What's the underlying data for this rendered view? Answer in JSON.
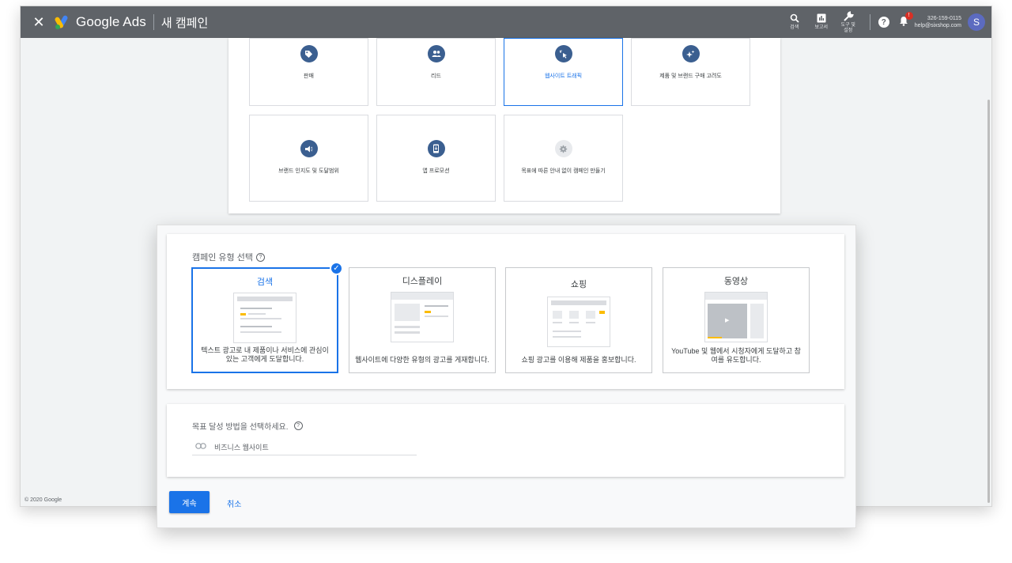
{
  "header": {
    "close_icon": "close-icon",
    "brand": "Google Ads",
    "page_title": "새 캠페인",
    "tools": [
      {
        "icon": "search-icon",
        "label": "검색"
      },
      {
        "icon": "reports-icon",
        "label": "보고서"
      },
      {
        "icon": "wrench-icon",
        "label": "도구 및 설정"
      }
    ],
    "notification_badge": "!",
    "account": {
      "id": "326-159-0115",
      "email": "help@sixshop.com",
      "avatar_letter": "S"
    }
  },
  "goals": [
    {
      "label": "판매",
      "icon": "tag-icon",
      "selected": false
    },
    {
      "label": "리드",
      "icon": "people-icon",
      "selected": false
    },
    {
      "label": "웹사이트 트래픽",
      "icon": "cursor-click-icon",
      "selected": true
    },
    {
      "label": "제품 및 브랜드 구매 고려도",
      "icon": "sparkle-icon",
      "selected": false
    },
    {
      "label": "브랜드 인지도 및 도달범위",
      "icon": "megaphone-icon",
      "selected": false
    },
    {
      "label": "앱 프로모션",
      "icon": "phone-icon",
      "selected": false
    },
    {
      "label": "목표에 따른 안내 없이 캠페인 만들기",
      "icon": "gear-icon",
      "selected": false
    }
  ],
  "campaign_type": {
    "title": "캠페인 유형 선택",
    "types": [
      {
        "name": "검색",
        "desc": "텍스트 광고로 내 제품이나 서비스에 관심이 있는 고객에게 도달합니다.",
        "selected": true
      },
      {
        "name": "디스플레이",
        "desc": "웹사이트에 다양한 유형의 광고를 게재합니다.",
        "selected": false
      },
      {
        "name": "쇼핑",
        "desc": "쇼핑 광고를 이용해 제품을 홍보합니다.",
        "selected": false
      },
      {
        "name": "동영상",
        "desc": "YouTube 및 웹에서 시청자에게 도달하고 참여를 유도합니다.",
        "selected": false
      }
    ]
  },
  "method": {
    "title": "목표 달성 방법을 선택하세요.",
    "field_label": "비즈니스 웹사이트"
  },
  "actions": {
    "continue": "계속",
    "cancel": "취소"
  },
  "footer": {
    "copyright": "© 2020 Google"
  },
  "colors": {
    "topbar": "#5f6368",
    "accent": "#1a73e8",
    "goal_icon": "#3b5f90"
  }
}
